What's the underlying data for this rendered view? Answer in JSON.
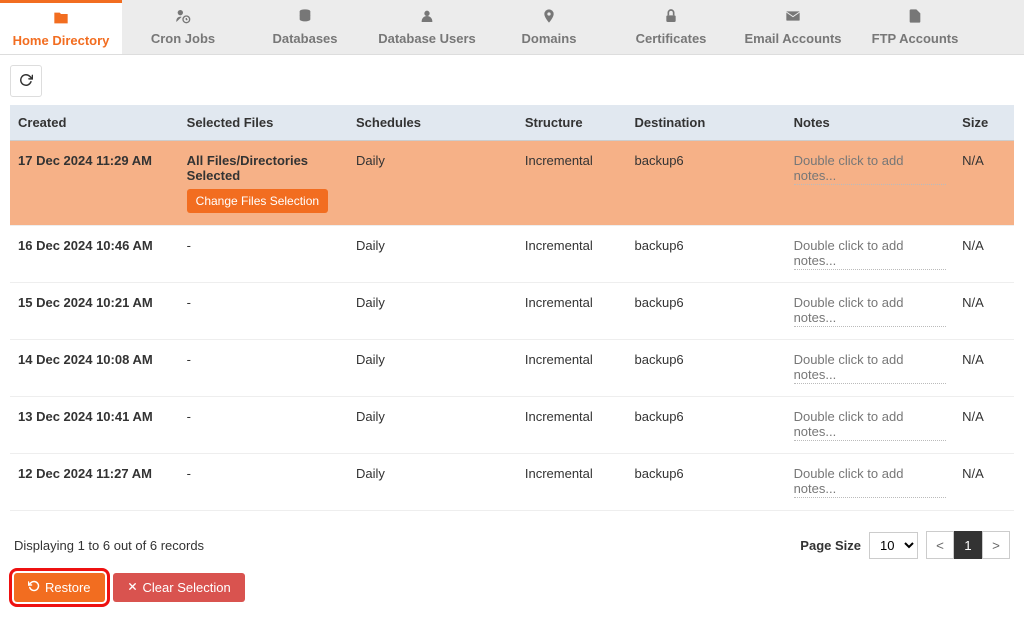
{
  "tabs": [
    {
      "label": "Home Directory",
      "icon": "folder",
      "active": true
    },
    {
      "label": "Cron Jobs",
      "icon": "user-clock",
      "active": false
    },
    {
      "label": "Databases",
      "icon": "database",
      "active": false
    },
    {
      "label": "Database Users",
      "icon": "user",
      "active": false
    },
    {
      "label": "Domains",
      "icon": "pin",
      "active": false
    },
    {
      "label": "Certificates",
      "icon": "lock",
      "active": false
    },
    {
      "label": "Email Accounts",
      "icon": "envelope",
      "active": false
    },
    {
      "label": "FTP Accounts",
      "icon": "file",
      "active": false
    }
  ],
  "columns": {
    "created": "Created",
    "selected_files": "Selected Files",
    "schedules": "Schedules",
    "structure": "Structure",
    "destination": "Destination",
    "notes": "Notes",
    "size": "Size"
  },
  "rows": [
    {
      "selected": true,
      "created": "17 Dec 2024 11:29 AM",
      "selected_files_line1": "All Files/Directories",
      "selected_files_line2": "Selected",
      "change_btn": "Change Files Selection",
      "schedules": "Daily",
      "structure": "Incremental",
      "destination": "backup6",
      "notes": "Double click to add notes...",
      "size": "N/A"
    },
    {
      "selected": false,
      "created": "16 Dec 2024 10:46 AM",
      "selected_files_line1": "-",
      "schedules": "Daily",
      "structure": "Incremental",
      "destination": "backup6",
      "notes": "Double click to add notes...",
      "size": "N/A"
    },
    {
      "selected": false,
      "created": "15 Dec 2024 10:21 AM",
      "selected_files_line1": "-",
      "schedules": "Daily",
      "structure": "Incremental",
      "destination": "backup6",
      "notes": "Double click to add notes...",
      "size": "N/A"
    },
    {
      "selected": false,
      "created": "14 Dec 2024 10:08 AM",
      "selected_files_line1": "-",
      "schedules": "Daily",
      "structure": "Incremental",
      "destination": "backup6",
      "notes": "Double click to add notes...",
      "size": "N/A"
    },
    {
      "selected": false,
      "created": "13 Dec 2024 10:41 AM",
      "selected_files_line1": "-",
      "schedules": "Daily",
      "structure": "Incremental",
      "destination": "backup6",
      "notes": "Double click to add notes...",
      "size": "N/A"
    },
    {
      "selected": false,
      "created": "12 Dec 2024 11:27 AM",
      "selected_files_line1": "-",
      "schedules": "Daily",
      "structure": "Incremental",
      "destination": "backup6",
      "notes": "Double click to add notes...",
      "size": "N/A"
    }
  ],
  "footer": {
    "display_text": "Displaying 1 to 6 out of 6 records",
    "page_size_label": "Page Size",
    "page_size_value": "10",
    "prev": "<",
    "current": "1",
    "next": ">"
  },
  "actions": {
    "restore": "Restore",
    "clear": "Clear Selection"
  }
}
